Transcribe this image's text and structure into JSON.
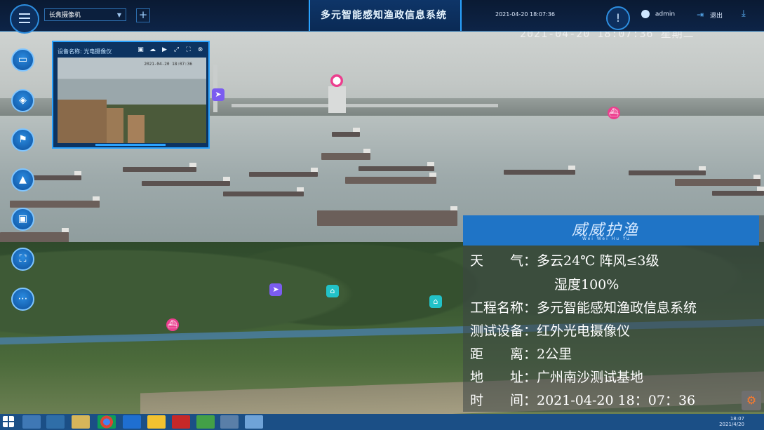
{
  "header": {
    "camera_select": "长焦摄像机",
    "add_label": "+",
    "title": "多元智能感知渔政信息系统",
    "datetime": "2021-04-20 18:07:36",
    "user": "admin",
    "logout": "退出"
  },
  "osd": {
    "timestamp": "2021-04-20 18:07:36 星期二"
  },
  "left_rail": {
    "items": [
      {
        "icon": "folder-icon"
      },
      {
        "icon": "layers-icon"
      },
      {
        "icon": "flag-icon"
      },
      {
        "icon": "alarm-light-icon"
      },
      {
        "icon": "save-icon"
      },
      {
        "icon": "network-icon"
      },
      {
        "icon": "more-icon"
      }
    ]
  },
  "camera_popup": {
    "device_label": "设备名称: 光电摄像仪",
    "osd": "2021-04-20 18:07:36"
  },
  "info_panel": {
    "logo": "威威护渔",
    "logo_sub": "Wei Wei Hu Yu",
    "weather": "天　　气：多云24℃ 阵风≤3级",
    "humidity": "湿度100%",
    "project": "工程名称：多元智能感知渔政信息系统",
    "device": "测试设备：红外光电摄像仪",
    "distance": "距　　离：2公里",
    "address": "地　　址：广州南沙测试基地",
    "time": "时　　间：2021-04-20 18：07：36"
  },
  "taskbar": {
    "clock_time": "18:07",
    "clock_date": "2021/4/20"
  }
}
